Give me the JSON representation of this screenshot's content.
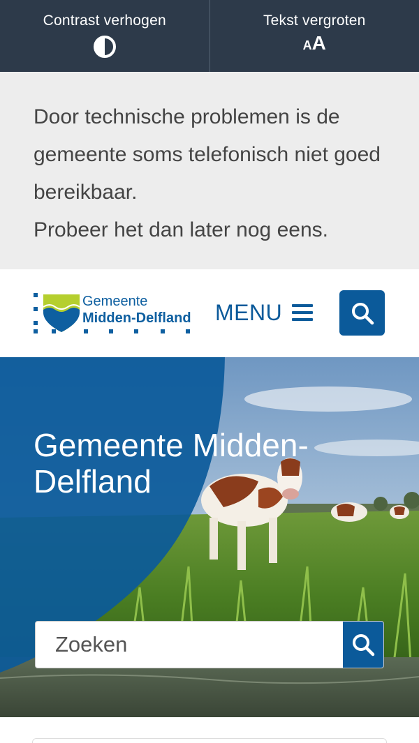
{
  "accessibility_bar": {
    "contrast_label": "Contrast verhogen",
    "contrast_icon": "contrast-icon",
    "text_size_label": "Tekst vergroten",
    "text_size_icon_small": "A",
    "text_size_icon_big": "A"
  },
  "notice": {
    "line1": "Door technische problemen is de gemeente soms telefonisch niet goed bereikbaar.",
    "line2": "Probeer het dan later nog eens."
  },
  "header": {
    "logo_line1": "Gemeente",
    "logo_line2": "Midden-Delfland",
    "menu_label": "MENU",
    "search_icon": "search-icon"
  },
  "hero": {
    "title": "Gemeente Midden-Delfland",
    "search_placeholder": "Zoeken"
  },
  "colors": {
    "a11y_bar_bg": "#2d3a4a",
    "notice_bg": "#ededed",
    "brand_blue": "#0b5a9a",
    "logo_green": "#b5cf2e"
  }
}
